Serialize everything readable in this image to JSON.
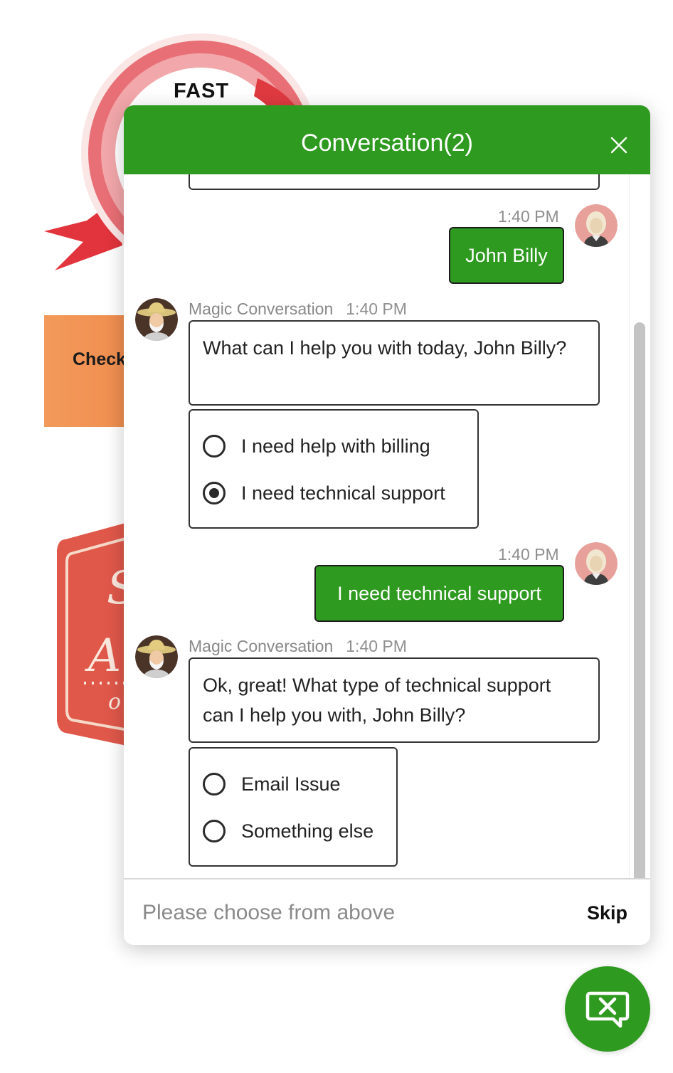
{
  "background": {
    "badge_text": "FAST",
    "button_label": "Check"
  },
  "chat": {
    "title": "Conversation(2)",
    "messages": [
      {
        "time": "1:40 PM",
        "text": "John Billy"
      },
      {
        "sender": "Magic Conversation",
        "time": "1:40 PM",
        "text": "What can I help you with today, John Billy?"
      },
      {
        "options": [
          "I need help with billing",
          "I need technical support"
        ],
        "selected": "I need technical support"
      },
      {
        "time": "1:40 PM",
        "text": "I need technical support"
      },
      {
        "sender": "Magic Conversation",
        "time": "1:40 PM",
        "text": "Ok, great! What type of technical support can I help you with, John Billy?"
      },
      {
        "options": [
          "Email Issue",
          "Something else"
        ]
      }
    ],
    "footer": {
      "placeholder": "Please choose from above",
      "skip_label": "Skip"
    }
  },
  "colors": {
    "accent": "#2f9a20",
    "badge_red": "#e0474c",
    "orange_button": "#f39a5a"
  },
  "icons": {
    "close": "close-icon",
    "launcher": "chat-close-icon",
    "bot_avatar": "sombrero-man-avatar",
    "user_avatar": "user-avatar"
  }
}
